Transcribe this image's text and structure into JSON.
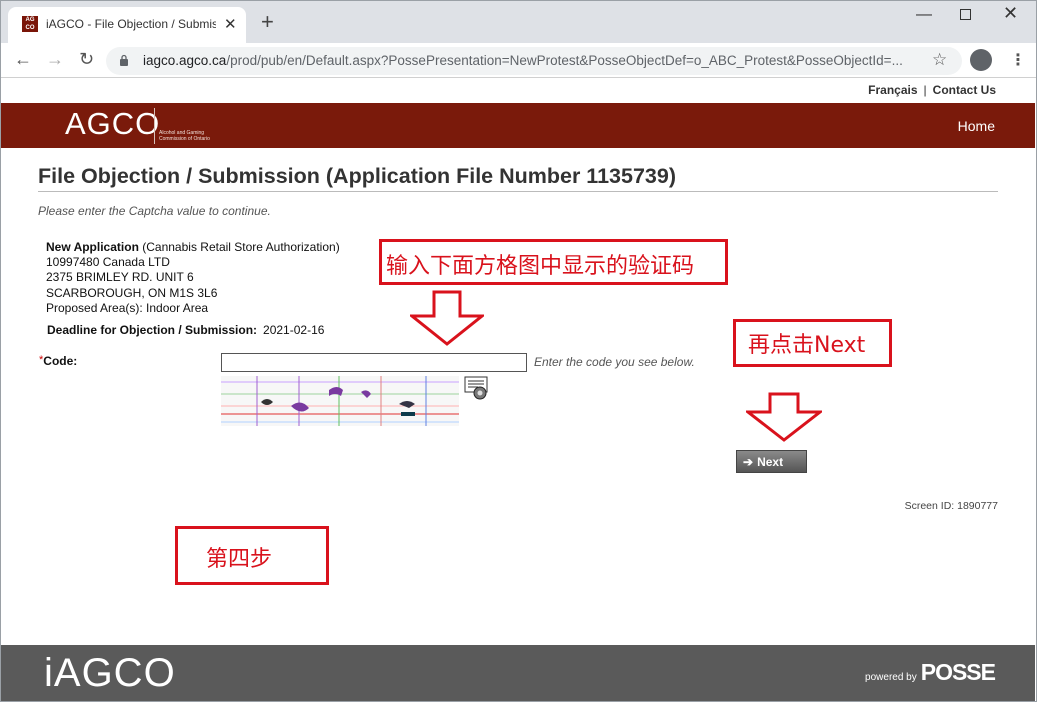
{
  "browser": {
    "tab_title": "iAGCO - File Objection / Submission (Application File Number 1135739)",
    "favicon_text": "AG CO",
    "url_host": "iagco.agco.ca",
    "url_path": "/prod/pub/en/Default.aspx?PossePresentation=NewProtest&PosseObjectDef=o_ABC_Protest&PosseObjectId=..."
  },
  "top_links": {
    "francais": "Français",
    "separator": "|",
    "contact": "Contact Us"
  },
  "header": {
    "logo": "AGCO",
    "logo_subtitle": "Alcohol and Gaming Commission of Ontario",
    "home": "Home"
  },
  "page": {
    "title": "File Objection / Submission (Application File Number 1135739)",
    "intro": "Please enter the Captcha value to continue."
  },
  "application": {
    "type_label": "New Application",
    "type_detail": "(Cannabis Retail Store Authorization)",
    "company": "10997480 Canada LTD",
    "address_line1": "2375 BRIMLEY RD. UNIT 6",
    "address_line2": "SCARBOROUGH, ON M1S 3L6",
    "proposed_area": "Proposed Area(s): Indoor Area",
    "deadline_label": "Deadline for Objection / Submission:",
    "deadline_value": "2021-02-16"
  },
  "form": {
    "required_marker": "*",
    "code_label": "Code:",
    "code_value": "",
    "code_hint": "Enter the code you see below.",
    "next_label": "Next"
  },
  "screen_id": "Screen ID: 1890777",
  "annotations": {
    "step1": "输入下面方格图中显示的验证码",
    "step2": "再点击Next",
    "step_title": "第四步"
  },
  "footer": {
    "logo": "iAGCO",
    "powered_by": "powered by",
    "posse": "POSSE"
  },
  "colors": {
    "brand_maroon": "#7a1a0b",
    "annotation_red": "#d9121c",
    "footer_gray": "#5a5a5a"
  }
}
